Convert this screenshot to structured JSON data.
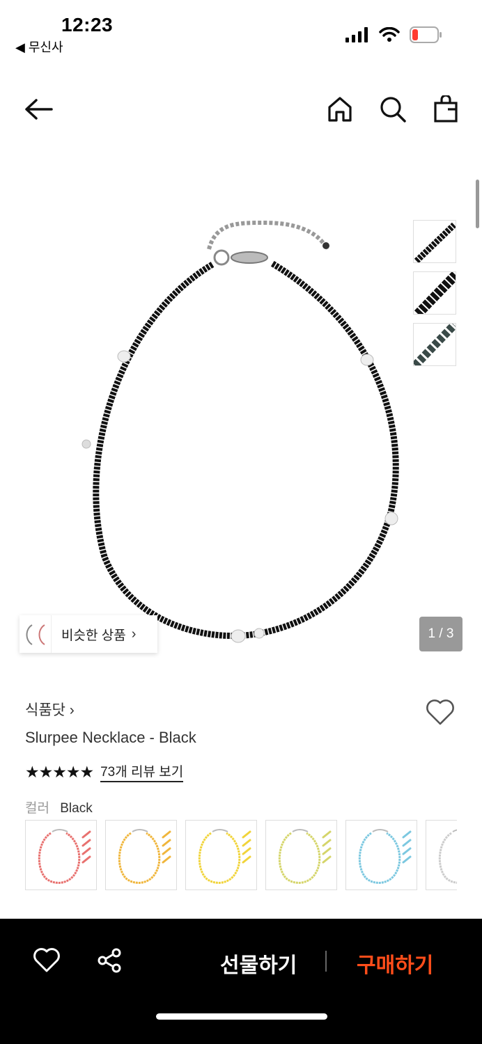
{
  "status_bar": {
    "time": "12:23",
    "back_app": "◀ 무신사"
  },
  "nav": {
    "back_icon": "arrow-left-icon",
    "home_icon": "home-icon",
    "search_icon": "search-icon",
    "cart_icon": "bag-icon"
  },
  "gallery": {
    "page_counter": "1 / 3",
    "similar_label": "비슷한 상품",
    "similar_chevron": "›"
  },
  "product": {
    "brand": "식품닷 ›",
    "title": "Slurpee Necklace - Black",
    "stars": "★★★★★",
    "rating": 5,
    "review_link": "73개 리뷰 보기",
    "color_label": "컬러",
    "color_value": "Black",
    "color_swatches": [
      "#e8716f",
      "#f0b63c",
      "#f1d43a",
      "#d5d56a",
      "#7cc8e0",
      "#cccccc"
    ]
  },
  "bottom_bar": {
    "gift_label": "선물하기",
    "buy_label": "구매하기",
    "buy_color": "#ff4d1a"
  }
}
